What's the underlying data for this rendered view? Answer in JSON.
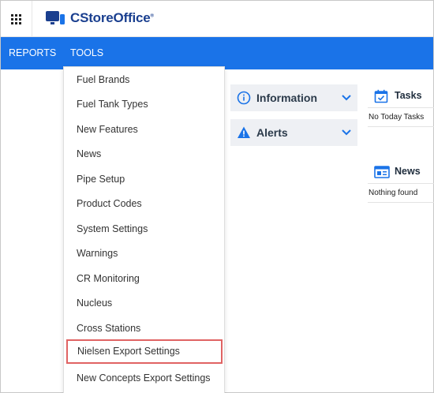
{
  "header": {
    "app_name": "CStoreOffice",
    "trademark": "®",
    "icons": {
      "apps": "grid-icon",
      "logo": "monitor-logo-icon"
    }
  },
  "nav": {
    "items": [
      {
        "label": "REPORTS"
      },
      {
        "label": "TOOLS"
      }
    ]
  },
  "tools_menu": {
    "items": [
      {
        "label": "Fuel Brands"
      },
      {
        "label": "Fuel Tank Types"
      },
      {
        "label": "New Features"
      },
      {
        "label": "News"
      },
      {
        "label": "Pipe Setup"
      },
      {
        "label": "Product Codes"
      },
      {
        "label": "System Settings"
      },
      {
        "label": "Warnings"
      },
      {
        "label": "CR Monitoring"
      },
      {
        "label": "Nucleus"
      },
      {
        "label": "Cross Stations"
      },
      {
        "label": "Nielsen Export Settings",
        "highlighted": true
      },
      {
        "label": "New Concepts Export Settings"
      }
    ],
    "highlight_color": "#e06363"
  },
  "panels": {
    "information": {
      "title": "Information",
      "icon": "info-icon"
    },
    "alerts": {
      "title": "Alerts",
      "icon": "warning-icon"
    }
  },
  "widgets": {
    "tasks": {
      "title": "Tasks",
      "empty_text": "No Today Tasks",
      "icon": "calendar-check-icon"
    },
    "news": {
      "title": "News",
      "empty_text": "Nothing found",
      "icon": "newspaper-icon"
    }
  },
  "colors": {
    "accent": "#1a73e8",
    "brand": "#1a3f8f"
  }
}
